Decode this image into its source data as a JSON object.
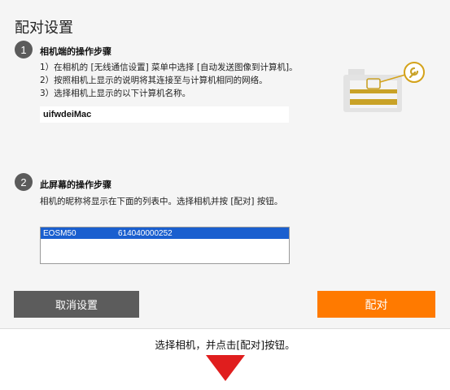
{
  "dialog": {
    "title": "配对设置",
    "step1": {
      "number": "1",
      "heading": "相机端的操作步骤",
      "lines": [
        "1）在相机的 [无线通信设置] 菜单中选择 [自动发送图像到计算机]。",
        "2）按照相机上显示的说明将其连接至与计算机相同的网络。",
        "3）选择相机上显示的以下计算机名称。"
      ],
      "computer_name": "uifwdeiMac"
    },
    "step2": {
      "number": "2",
      "heading": "此屏幕的操作步骤",
      "text": "相机的昵称将显示在下面的列表中。选择相机并按 [配对] 按钮。",
      "camera_list": [
        {
          "model": "EOSM50",
          "serial": "614040000252",
          "selected": true
        }
      ]
    },
    "buttons": {
      "cancel": "取消设置",
      "pair": "配对"
    }
  },
  "caption": "选择相机，并点击[配对]按钮。",
  "colors": {
    "accent": "#ff7a00",
    "selection": "#1a5fcf",
    "gold": "#d4a21a",
    "arrow": "#e01e1e"
  },
  "icons": {
    "camera": "camera-settings-illustration",
    "arrow": "down-triangle-arrow"
  }
}
